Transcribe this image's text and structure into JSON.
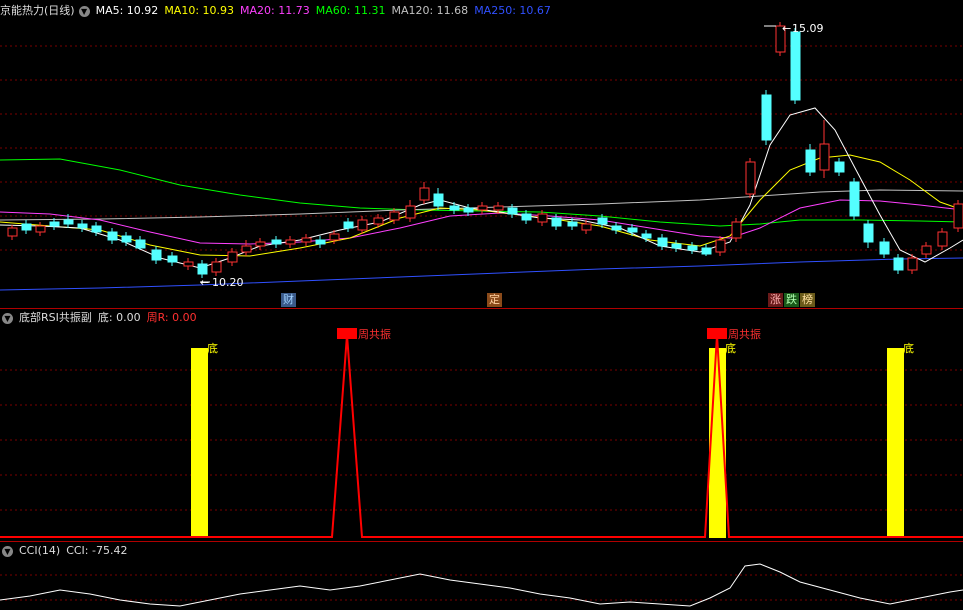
{
  "main_panel": {
    "title": "京能热力(日线)",
    "ma_labels": [
      {
        "text": "MA5: 10.92",
        "color": "#ffffff"
      },
      {
        "text": "MA10: 10.93",
        "color": "#ffff00"
      },
      {
        "text": "MA20: 11.73",
        "color": "#ff40ff"
      },
      {
        "text": "MA60: 11.31",
        "color": "#00ff00"
      },
      {
        "text": "MA120: 11.68",
        "color": "#c0c0c0"
      },
      {
        "text": "MA250: 10.67",
        "color": "#3050ff"
      }
    ],
    "high_label": "15.09",
    "low_label": "10.20",
    "event_tags": [
      {
        "text": "财",
        "bg": "#3a5a8a",
        "fg": "#9fd0ff"
      },
      {
        "text": "定",
        "bg": "#8a4a1a",
        "fg": "#ffd0a0"
      },
      {
        "text": "涨",
        "bg": "#6a1a1a",
        "fg": "#ffb0b0"
      },
      {
        "text": "跌",
        "bg": "#1a5a1a",
        "fg": "#b0ffb0"
      },
      {
        "text": "榜",
        "bg": "#6a5a1a",
        "fg": "#ffe0a0"
      }
    ]
  },
  "sub_panel": {
    "title": "底部RSI共振副",
    "di_label": "底: 0.00",
    "zhou_label": "周R: 0.00",
    "bar_label": "底",
    "resonance_label": "周共振"
  },
  "cci_panel": {
    "title": "CCI(14)",
    "value_label": "CCI: -75.42"
  },
  "colors": {
    "up": "#ff3232",
    "down": "#54ffff",
    "grid": "#7a0000",
    "signal_bar": "#ffff00",
    "signal_line": "#ff0000"
  }
}
